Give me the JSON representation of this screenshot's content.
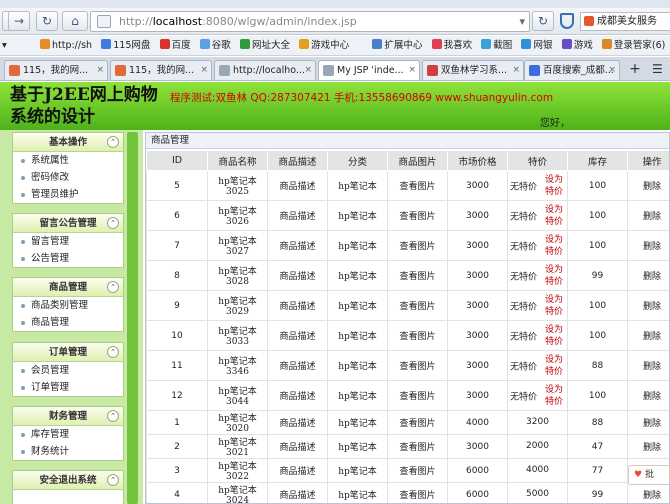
{
  "browser": {
    "url_prefix": "http://",
    "url_host": "localhost",
    "url_path": ":8080/wlgw/admin/index.jsp",
    "right_badge": "成都美女服务",
    "favorites": [
      "http://sh",
      "115网盘",
      "百度",
      "谷歌",
      "网址大全",
      "游戏中心",
      "扩展中心",
      "我喜欢",
      "截图",
      "网银",
      "游戏",
      "登录管家(6)"
    ],
    "tabs": [
      "115，我的网...",
      "115，我的网...",
      "http://localho...",
      "My JSP 'inde...",
      "双鱼林学习系...",
      "百度搜索_成都..."
    ],
    "new_tab": "+"
  },
  "banner": {
    "title": "基于J2EE网上购物系统的设计",
    "contact": "程序测试:双鱼林 QQ:287307421 手机:13558690869 www.shuangyulin.com",
    "greeting": "您好，"
  },
  "sidebar": [
    {
      "title": "基本操作",
      "items": [
        "系统属性",
        "密码修改",
        "管理员维护"
      ]
    },
    {
      "title": "留言公告管理",
      "items": [
        "留言管理",
        "公告管理"
      ]
    },
    {
      "title": "商品管理",
      "items": [
        "商品类别管理",
        "商品管理"
      ]
    },
    {
      "title": "订单管理",
      "items": [
        "会员管理",
        "订单管理"
      ]
    },
    {
      "title": "财务管理",
      "items": [
        "库存管理",
        "财务统计"
      ]
    },
    {
      "title": "安全退出系统",
      "items": []
    }
  ],
  "main": {
    "title": "商品管理",
    "columns": [
      "ID",
      "商品名称",
      "商品描述",
      "分类",
      "商品图片",
      "市场价格",
      "特价",
      "库存",
      "操作"
    ],
    "rows": [
      {
        "id": "5",
        "name": "hp笔记本3025",
        "desc": "商品描述",
        "cat": "hp笔记本",
        "img": "查看图片",
        "price": "3000",
        "special": "无特价",
        "set": "设为特价",
        "stock": "100",
        "op": "删除"
      },
      {
        "id": "6",
        "name": "hp笔记本3026",
        "desc": "商品描述",
        "cat": "hp笔记本",
        "img": "查看图片",
        "price": "3000",
        "special": "无特价",
        "set": "设为特价",
        "stock": "100",
        "op": "删除"
      },
      {
        "id": "7",
        "name": "hp笔记本3027",
        "desc": "商品描述",
        "cat": "hp笔记本",
        "img": "查看图片",
        "price": "3000",
        "special": "无特价",
        "set": "设为特价",
        "stock": "100",
        "op": "删除"
      },
      {
        "id": "8",
        "name": "hp笔记本3028",
        "desc": "商品描述",
        "cat": "hp笔记本",
        "img": "查看图片",
        "price": "3000",
        "special": "无特价",
        "set": "设为特价",
        "stock": "99",
        "op": "删除"
      },
      {
        "id": "9",
        "name": "hp笔记本3029",
        "desc": "商品描述",
        "cat": "hp笔记本",
        "img": "查看图片",
        "price": "3000",
        "special": "无特价",
        "set": "设为特价",
        "stock": "100",
        "op": "删除"
      },
      {
        "id": "10",
        "name": "hp笔记本3033",
        "desc": "商品描述",
        "cat": "hp笔记本",
        "img": "查看图片",
        "price": "3000",
        "special": "无特价",
        "set": "设为特价",
        "stock": "100",
        "op": "删除"
      },
      {
        "id": "11",
        "name": "hp笔记本3346",
        "desc": "商品描述",
        "cat": "hp笔记本",
        "img": "查看图片",
        "price": "3000",
        "special": "无特价",
        "set": "设为特价",
        "stock": "88",
        "op": "删除"
      },
      {
        "id": "12",
        "name": "hp笔记本3044",
        "desc": "商品描述",
        "cat": "hp笔记本",
        "img": "查看图片",
        "price": "3000",
        "special": "无特价",
        "set": "设为特价",
        "stock": "100",
        "op": "删除"
      },
      {
        "id": "1",
        "name": "hp笔记本3020",
        "desc": "商品描述",
        "cat": "hp笔记本",
        "img": "查看图片",
        "price": "4000",
        "special": "3200",
        "set": "",
        "stock": "88",
        "op": "删除"
      },
      {
        "id": "2",
        "name": "hp笔记本3021",
        "desc": "商品描述",
        "cat": "hp笔记本",
        "img": "查看图片",
        "price": "3000",
        "special": "2000",
        "set": "",
        "stock": "47",
        "op": "删除"
      },
      {
        "id": "3",
        "name": "hp笔记本3022",
        "desc": "商品描述",
        "cat": "hp笔记本",
        "img": "查看图片",
        "price": "6000",
        "special": "4000",
        "set": "",
        "stock": "77",
        "op": "删除"
      },
      {
        "id": "4",
        "name": "hp笔记本3024",
        "desc": "商品描述",
        "cat": "hp笔记本",
        "img": "查看图片",
        "price": "6000",
        "special": "5000",
        "set": "",
        "stock": "99",
        "op": "删除"
      }
    ]
  },
  "feedback_label": "批"
}
